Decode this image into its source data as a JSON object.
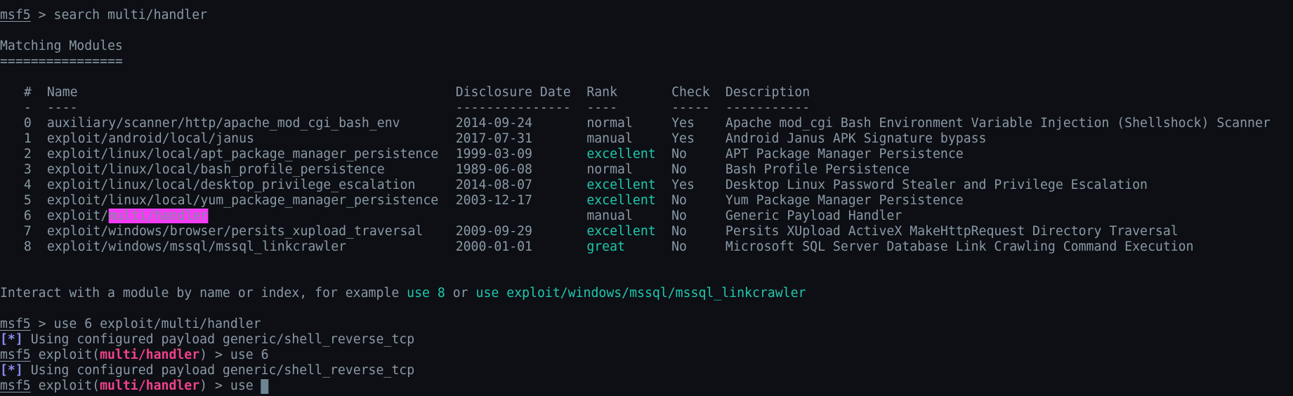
{
  "prompt": "msf5",
  "search_command": {
    "prompt_sep": " > ",
    "command": "search multi/handler"
  },
  "matching_title": "Matching Modules",
  "matching_underline": "================",
  "table": {
    "headers": {
      "num": "#",
      "name": "Name",
      "date": "Disclosure Date",
      "rank": "Rank",
      "check": "Check",
      "desc": "Description"
    },
    "separators": {
      "num": "-",
      "name": "----",
      "date": "---------------",
      "rank": "----",
      "check": "-----",
      "desc": "-----------"
    },
    "rows": [
      {
        "num": "0",
        "name": "auxiliary/scanner/http/apache_mod_cgi_bash_env",
        "date": "2014-09-24",
        "rank": "normal",
        "check": "Yes",
        "desc": "Apache mod_cgi Bash Environment Variable Injection (Shellshock) Scanner"
      },
      {
        "num": "1",
        "name": "exploit/android/local/janus",
        "date": "2017-07-31",
        "rank": "manual",
        "check": "Yes",
        "desc": "Android Janus APK Signature bypass"
      },
      {
        "num": "2",
        "name": "exploit/linux/local/apt_package_manager_persistence",
        "date": "1999-03-09",
        "rank": "excellent",
        "check": "No",
        "desc": "APT Package Manager Persistence"
      },
      {
        "num": "3",
        "name": "exploit/linux/local/bash_profile_persistence",
        "date": "1989-06-08",
        "rank": "normal",
        "check": "No",
        "desc": "Bash Profile Persistence"
      },
      {
        "num": "4",
        "name": "exploit/linux/local/desktop_privilege_escalation",
        "date": "2014-08-07",
        "rank": "excellent",
        "check": "Yes",
        "desc": "Desktop Linux Password Stealer and Privilege Escalation"
      },
      {
        "num": "5",
        "name": "exploit/linux/local/yum_package_manager_persistence",
        "date": "2003-12-17",
        "rank": "excellent",
        "check": "No",
        "desc": "Yum Package Manager Persistence"
      },
      {
        "num": "6",
        "name_prefix": "exploit/",
        "name_highlight": "multi/handler",
        "date": "",
        "rank": "manual",
        "check": "No",
        "desc": "Generic Payload Handler"
      },
      {
        "num": "7",
        "name": "exploit/windows/browser/persits_xupload_traversal",
        "date": "2009-09-29",
        "rank": "excellent",
        "check": "No",
        "desc": "Persits XUpload ActiveX MakeHttpRequest Directory Traversal"
      },
      {
        "num": "8",
        "name": "exploit/windows/mssql/mssql_linkcrawler",
        "date": "2000-01-01",
        "rank": "great",
        "check": "No",
        "desc": "Microsoft SQL Server Database Link Crawling Command Execution"
      }
    ]
  },
  "hint": {
    "text_before": "Interact with a module by name or index, for example ",
    "example1": "use 8",
    "text_mid": " or ",
    "example2": "use exploit/windows/mssql/mssql_linkcrawler"
  },
  "history": [
    {
      "type": "prompt",
      "context": "",
      "sep": " > ",
      "command": "use 6 exploit/multi/handler"
    },
    {
      "type": "info",
      "marker": "[*]",
      "text": " Using configured payload generic/shell_reverse_tcp"
    },
    {
      "type": "prompt",
      "context_prefix": " exploit(",
      "context_module": "multi/handler",
      "context_suffix": ")",
      "sep": " > ",
      "command": "use 6"
    },
    {
      "type": "info",
      "marker": "[*]",
      "text": " Using configured payload generic/shell_reverse_tcp"
    },
    {
      "type": "prompt",
      "context_prefix": " exploit(",
      "context_module": "multi/handler",
      "context_suffix": ")",
      "sep": " > ",
      "command": "use "
    }
  ],
  "colors": {
    "background": "#0d0f14",
    "foreground": "#8a99a6",
    "accent_green": "#1fc9b0",
    "module_pink": "#f0418c",
    "highlight_magenta": "#f43cf4",
    "info_marker": "#8c8cf0"
  }
}
